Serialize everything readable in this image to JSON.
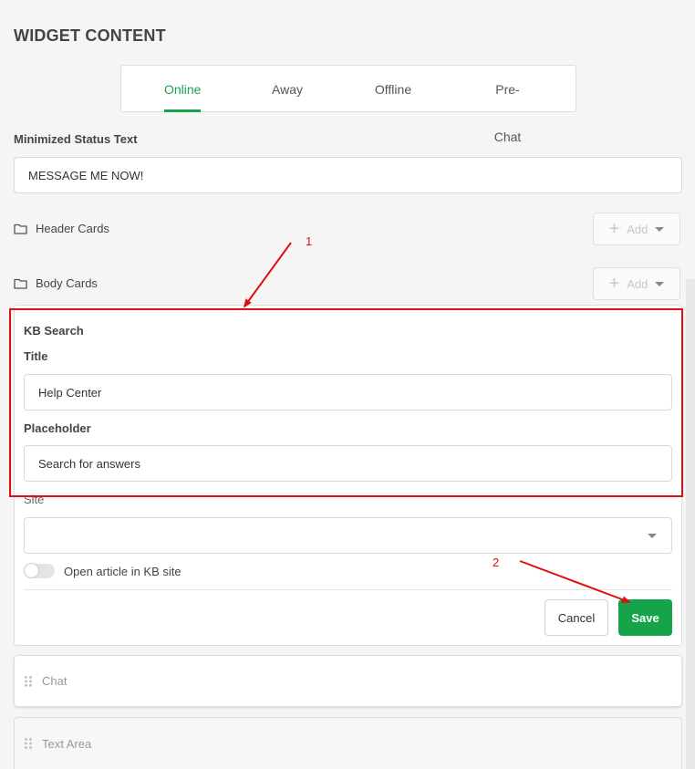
{
  "section_title": "WIDGET CONTENT",
  "tabs": [
    {
      "label": "Online",
      "active": true
    },
    {
      "label": "Away",
      "active": false
    },
    {
      "label": "Offline",
      "active": false
    },
    {
      "label": "Pre-Chat",
      "active": false
    }
  ],
  "minimized_status": {
    "label": "Minimized Status Text",
    "value": "MESSAGE ME NOW!"
  },
  "header_cards": {
    "label": "Header Cards",
    "add_label": "Add"
  },
  "body_cards": {
    "label": "Body Cards",
    "add_label": "Add"
  },
  "kb_search": {
    "section_label": "KB Search",
    "title_label": "Title",
    "title_value": "Help Center",
    "placeholder_label": "Placeholder",
    "placeholder_value": "Search for answers",
    "site_label": "Site",
    "site_value": "",
    "toggle_label": "Open article in KB site",
    "toggle_on": false,
    "cancel_label": "Cancel",
    "save_label": "Save"
  },
  "cards": [
    {
      "label": "Chat"
    },
    {
      "label": "Text Area"
    }
  ],
  "annotations": {
    "arrow_1": "1",
    "arrow_2": "2"
  },
  "colors": {
    "accent": "#16a34a",
    "annotation": "#e01010"
  }
}
